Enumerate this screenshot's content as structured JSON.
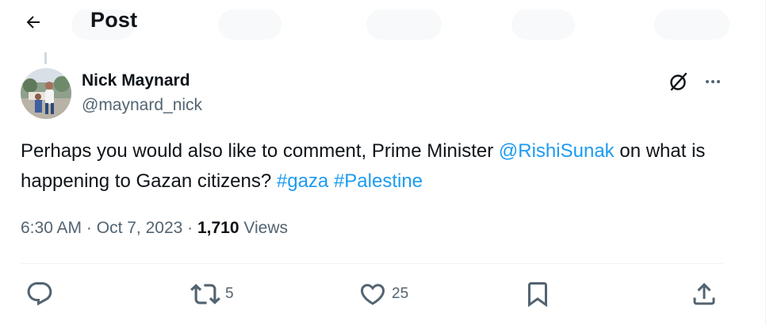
{
  "header": {
    "title": "Post"
  },
  "tweet": {
    "author_name": "Nick Maynard",
    "author_handle": "@maynard_nick",
    "text_part1": "Perhaps you would also like to comment, Prime Minister ",
    "mention": "@RishiSunak",
    "text_part2": " on what is happening to Gazan citizens? ",
    "hashtag1": "#gaza",
    "text_space": " ",
    "hashtag2": "#Palestine",
    "time": "6:30 AM",
    "separator": " · ",
    "date": "Oct 7, 2023",
    "views_count": "1,710",
    "views_label": " Views"
  },
  "actions": {
    "reply_count": "",
    "repost_count": "5",
    "like_count": "25"
  },
  "icons": {
    "back": "arrow-left-icon",
    "grok": "grok-icon",
    "more": "more-horizontal-icon",
    "reply": "reply-icon",
    "repost": "repost-icon",
    "like": "heart-icon",
    "bookmark": "bookmark-icon",
    "share": "share-icon"
  },
  "colors": {
    "link": "#1d9bf0",
    "secondary_text": "#536471",
    "primary_text": "#0f1419",
    "divider": "#eff3f4"
  }
}
